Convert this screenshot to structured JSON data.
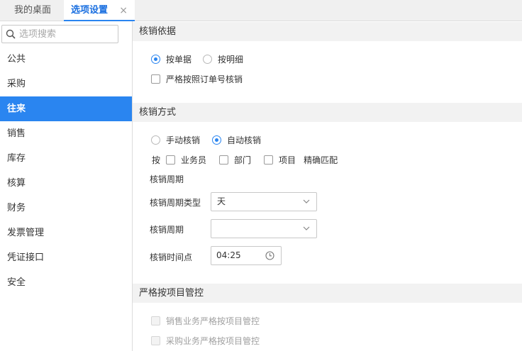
{
  "tabs": [
    {
      "label": "我的桌面",
      "active": false
    },
    {
      "label": "选项设置",
      "active": true,
      "close_icon": "×"
    }
  ],
  "sidebar": {
    "search_placeholder": "选项搜索",
    "items": [
      {
        "label": "公共"
      },
      {
        "label": "采购"
      },
      {
        "label": "往来",
        "active": true
      },
      {
        "label": "销售"
      },
      {
        "label": "库存"
      },
      {
        "label": "核算"
      },
      {
        "label": "财务"
      },
      {
        "label": "发票管理"
      },
      {
        "label": "凭证接口"
      },
      {
        "label": "安全"
      }
    ]
  },
  "basis": {
    "title": "核销依据",
    "radio_by_document": "按单据",
    "radio_by_detail": "按明细",
    "selected": "按单据",
    "strict_order_check": "严格按照订单号核销",
    "strict_order_checked": false
  },
  "method": {
    "title": "核销方式",
    "radio_manual": "手动核销",
    "radio_auto": "自动核销",
    "selected": "自动核销",
    "by_prefix": "按",
    "match_salesman": "业务员",
    "match_department": "部门",
    "match_project": "项目",
    "match_suffix": "精确匹配",
    "period_heading": "核销周期",
    "period_type_label": "核销周期类型",
    "period_type_value": "天",
    "period_label": "核销周期",
    "period_value": "",
    "time_label": "核销时间点",
    "time_value": "04:25"
  },
  "project_control": {
    "title": "严格按项目管控",
    "sales_control": "销售业务严格按项目管控",
    "purchase_control": "采购业务严格按项目管控"
  },
  "colors": {
    "accent": "#2a85f0",
    "section_bg": "#f2f2f2",
    "tabbar_bg": "#f0f0f0"
  }
}
